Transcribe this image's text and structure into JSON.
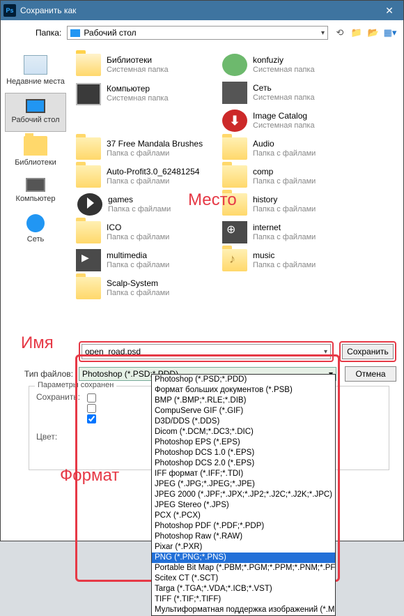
{
  "titlebar": {
    "title": "Сохранить как"
  },
  "toprow": {
    "label": "Папка:",
    "folder": "Рабочий стол"
  },
  "sidebar": [
    {
      "label": "Недавние места"
    },
    {
      "label": "Рабочий стол"
    },
    {
      "label": "Библиотеки"
    },
    {
      "label": "Компьютер"
    },
    {
      "label": "Сеть"
    }
  ],
  "files": [
    {
      "name": "Библиотеки",
      "sub": "Системная папка",
      "icon": "lib"
    },
    {
      "name": "konfuziy",
      "sub": "Системная папка",
      "icon": "user"
    },
    {
      "name": "Компьютер",
      "sub": "Системная папка",
      "icon": "comp"
    },
    {
      "name": "Сеть",
      "sub": "Системная папка",
      "icon": "net"
    },
    {
      "name": "Image Catalog",
      "sub": "Системная папка",
      "icon": "ic"
    },
    {
      "name": "37 Free Mandala Brushes",
      "sub": "Папка с файлами",
      "icon": "folder"
    },
    {
      "name": "Audio",
      "sub": "Папка с файлами",
      "icon": "folder"
    },
    {
      "name": "Auto-Profit3.0_62481254",
      "sub": "Папка с файлами",
      "icon": "folder"
    },
    {
      "name": "comp",
      "sub": "Папка с файлами",
      "icon": "folder"
    },
    {
      "name": "games",
      "sub": "Папка с файлами",
      "icon": "games"
    },
    {
      "name": "history",
      "sub": "Папка с файлами",
      "icon": "folder"
    },
    {
      "name": "ICO",
      "sub": "Папка с файлами",
      "icon": "folder"
    },
    {
      "name": "internet",
      "sub": "Папка с файлами",
      "icon": "net2"
    },
    {
      "name": "multimedia",
      "sub": "Папка с файлами",
      "icon": "mm"
    },
    {
      "name": "music",
      "sub": "Папка с файлами",
      "icon": "music"
    },
    {
      "name": "Scalp-System",
      "sub": "Папка с файлами",
      "icon": "folder"
    }
  ],
  "annotations": {
    "place": "Место",
    "name": "Имя",
    "format": "Формат"
  },
  "filename": {
    "label": "",
    "value": "open_road.psd"
  },
  "filetype": {
    "label": "Тип файлов:",
    "value": "Photoshop (*.PSD;*.PDD)"
  },
  "buttons": {
    "save": "Сохранить",
    "cancel": "Отмена"
  },
  "type_options": [
    "Photoshop (*.PSD;*.PDD)",
    "Формат больших документов (*.PSB)",
    "BMP (*.BMP;*.RLE;*.DIB)",
    "CompuServe GIF (*.GIF)",
    "D3D/DDS (*.DDS)",
    "Dicom (*.DCM;*.DC3;*.DIC)",
    "Photoshop EPS (*.EPS)",
    "Photoshop DCS 1.0 (*.EPS)",
    "Photoshop DCS 2.0 (*.EPS)",
    "IFF формат (*.IFF;*.TDI)",
    "JPEG (*.JPG;*.JPEG;*.JPE)",
    "JPEG 2000 (*.JPF;*.JPX;*.JP2;*.J2C;*.J2K;*.JPC)",
    "JPEG Stereo (*.JPS)",
    "PCX (*.PCX)",
    "Photoshop PDF (*.PDF;*.PDP)",
    "Photoshop Raw (*.RAW)",
    "Pixar (*.PXR)",
    "PNG (*.PNG;*.PNS)",
    "Portable Bit Map (*.PBM;*.PGM;*.PPM;*.PNM;*.PFM;*.PAM)",
    "Scitex CT (*.SCT)",
    "Targa (*.TGA;*.VDA;*.ICB;*.VST)",
    "TIFF (*.TIF;*.TIFF)",
    "Мультиформатная поддержка изображений  (*.MPO)"
  ],
  "selected_option_index": 17,
  "save_params": {
    "legend": "Параметры сохранен",
    "save_label": "Сохранить:",
    "color_label": "Цвет:"
  }
}
